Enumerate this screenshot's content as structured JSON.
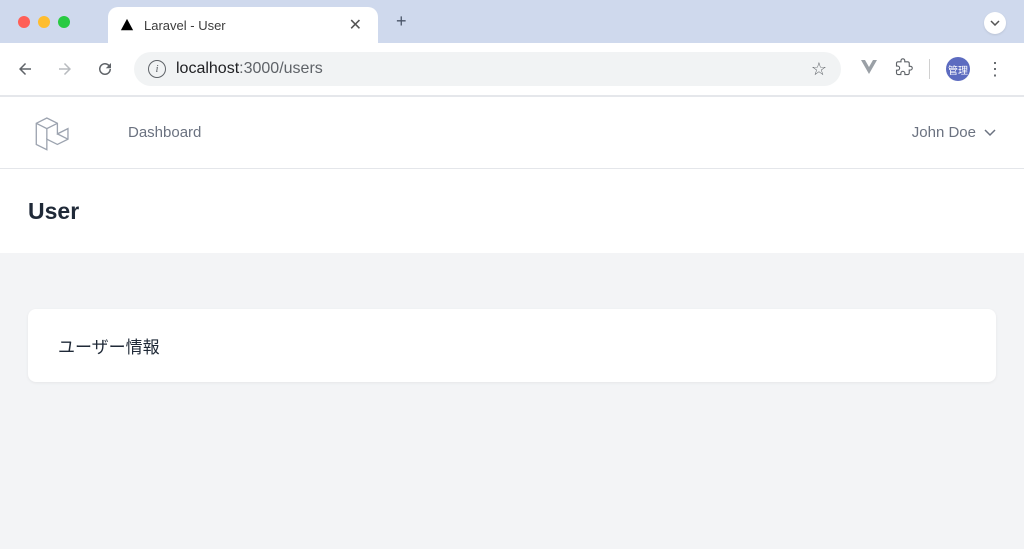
{
  "browser": {
    "tab_title": "Laravel - User",
    "url_host": "localhost",
    "url_port_path": ":3000/users",
    "profile_label": "管理"
  },
  "app": {
    "nav": {
      "dashboard": "Dashboard"
    },
    "user_name": "John Doe",
    "page_title": "User",
    "card_heading": "ユーザー情報"
  }
}
